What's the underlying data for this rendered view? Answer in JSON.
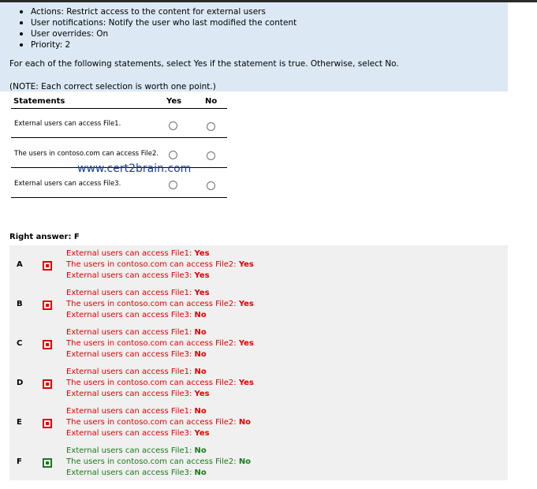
{
  "question": {
    "bullets": [
      "Actions: Restrict access to the content for external users",
      "User notifications: Notify the user who last modified the content",
      "User overrides: On",
      "Priority: 2"
    ],
    "instruction": "For each of the following statements, select Yes if the statement is true. Otherwise, select No.",
    "note": "(NOTE: Each correct selection is worth one point.)"
  },
  "table": {
    "headers": {
      "statements": "Statements",
      "yes": "Yes",
      "no": "No"
    },
    "rows": [
      {
        "statement": "External users can access File1."
      },
      {
        "statement": "The users in contoso.com can access File2."
      },
      {
        "statement": "External users can access File3."
      }
    ]
  },
  "watermark": "www.cert2brain.com",
  "right_answer": "Right answer: F",
  "options": [
    {
      "letter": "A",
      "status": "wrong",
      "lines": [
        {
          "label": "External users can access File1:",
          "value": "Yes"
        },
        {
          "label": "The users in contoso.com can access File2:",
          "value": "Yes"
        },
        {
          "label": "External users can access File3:",
          "value": "Yes"
        }
      ]
    },
    {
      "letter": "B",
      "status": "wrong",
      "lines": [
        {
          "label": "External users can access File1:",
          "value": "Yes"
        },
        {
          "label": "The users in contoso.com can access File2:",
          "value": "Yes"
        },
        {
          "label": "External users can access File3:",
          "value": "No"
        }
      ]
    },
    {
      "letter": "C",
      "status": "wrong",
      "lines": [
        {
          "label": "External users can access File1:",
          "value": "No"
        },
        {
          "label": "The users in contoso.com can access File2:",
          "value": "Yes"
        },
        {
          "label": "External users can access File3:",
          "value": "No"
        }
      ]
    },
    {
      "letter": "D",
      "status": "wrong",
      "lines": [
        {
          "label": "External users can access File1:",
          "value": "No"
        },
        {
          "label": "The users in contoso.com can access File2:",
          "value": "Yes"
        },
        {
          "label": "External users can access File3:",
          "value": "Yes"
        }
      ]
    },
    {
      "letter": "E",
      "status": "wrong",
      "lines": [
        {
          "label": "External users can access File1:",
          "value": "No"
        },
        {
          "label": "The users in contoso.com can access File2:",
          "value": "No"
        },
        {
          "label": "External users can access File3:",
          "value": "Yes"
        }
      ]
    },
    {
      "letter": "F",
      "status": "correct",
      "lines": [
        {
          "label": "External users can access File1:",
          "value": "No"
        },
        {
          "label": "The users in contoso.com can access File2:",
          "value": "No"
        },
        {
          "label": "External users can access File3:",
          "value": "No"
        }
      ]
    }
  ],
  "colors": {
    "wrong": "#e00000",
    "correct": "#1a7a1a",
    "panel_blue": "#dce9f5",
    "panel_gray": "#f0f0f0"
  }
}
